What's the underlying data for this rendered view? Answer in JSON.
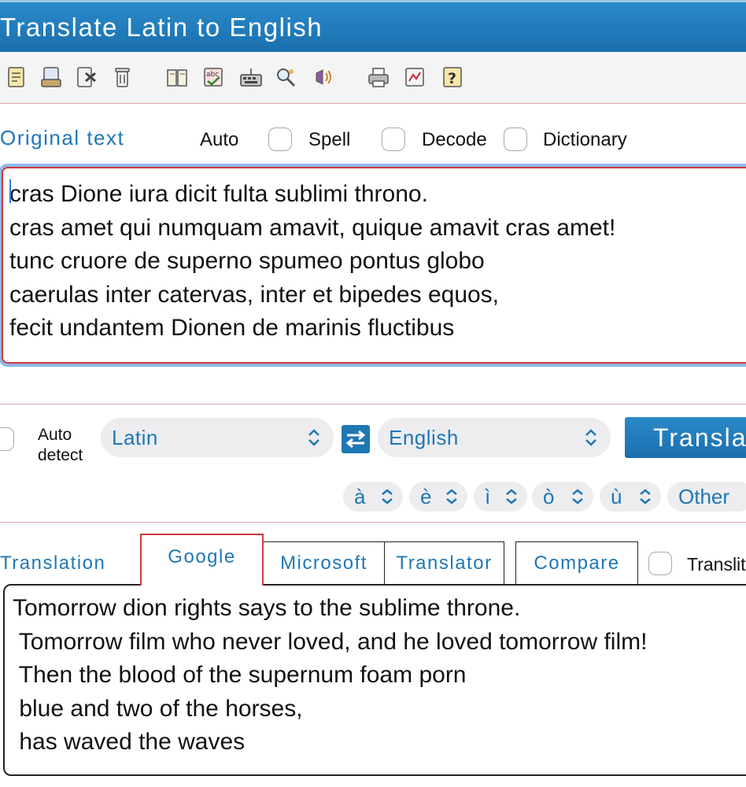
{
  "window": {
    "title": "Translate Latin to English"
  },
  "toolbar": {
    "icons": [
      "new-note-icon",
      "open-note-icon",
      "export-note-icon",
      "delete-note-icon",
      "dictionary-book-icon",
      "spell-check-icon",
      "keyboard-icon",
      "search-tools-icon",
      "speech-icon",
      "print-icon",
      "history-icon",
      "help-icon"
    ]
  },
  "original": {
    "label": "Original text",
    "options": {
      "auto": "Auto",
      "spell": "Spell",
      "decode": "Decode",
      "dictionary": "Dictionary"
    },
    "text": "cras Dione iura dicit fulta sublimi throno.\ncras amet qui numquam amavit, quique amavit cras amet!\ntunc cruore de superno spumeo pontus globo\ncaerulas inter catervas, inter et bipedes equos,\nfecit undantem Dionen de marinis fluctibus"
  },
  "languages": {
    "auto_detect_line1": "Auto",
    "auto_detect_line2": "detect",
    "source": "Latin",
    "target": "English",
    "translate_label": "Translate"
  },
  "accents": {
    "a": "à",
    "e": "è",
    "i": "ì",
    "o": "ò",
    "u": "ù",
    "other": "Other"
  },
  "translation": {
    "label": "Translation",
    "tabs": {
      "google": "Google",
      "microsoft": "Microsoft",
      "translator": "Translator",
      "compare": "Compare"
    },
    "transliteration": "Transliteration",
    "text": "Tomorrow dion rights says to the sublime throne.\n Tomorrow film who never loved, and he loved tomorrow film!\n Then the blood of the supernum foam porn\n blue and two of the horses,\n has waved the waves"
  },
  "colors": {
    "accent": "#1f77b4",
    "titlebar": "#1a6fae",
    "active_tab_border": "#d43a3a"
  }
}
